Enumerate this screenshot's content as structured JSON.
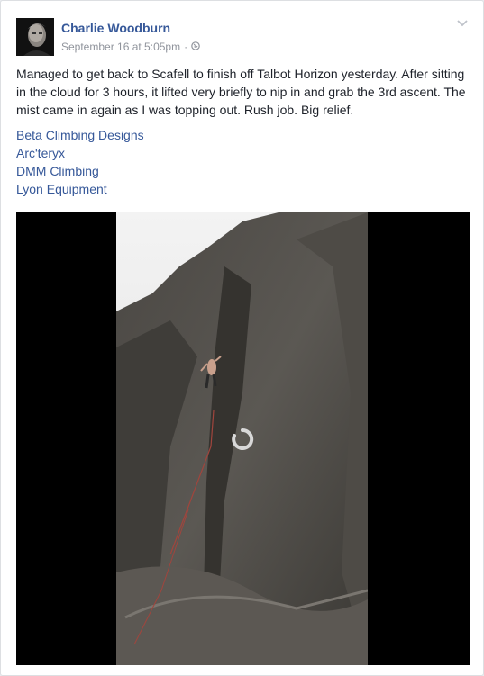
{
  "post": {
    "author": "Charlie Woodburn",
    "timestamp": "September 16 at 5:05pm",
    "separator": "·",
    "privacy_icon": "globe-icon",
    "menu_icon": "chevron-down-icon",
    "text": "Managed to get back to Scafell to finish off Talbot Horizon yesterday. After sitting in the cloud for 3 hours, it lifted very briefly to nip in and grab the 3rd ascent. The mist came in again as I was topping out. Rush job. Big relief.",
    "tags": [
      {
        "label": "Beta Climbing Designs"
      },
      {
        "label": "Arc'teryx"
      },
      {
        "label": "DMM Climbing"
      },
      {
        "label": "Lyon Equipment"
      }
    ],
    "video": {
      "loading_icon": "loading-spinner-icon"
    }
  },
  "colors": {
    "link": "#365899",
    "text": "#1d2129",
    "meta": "#90949c"
  }
}
